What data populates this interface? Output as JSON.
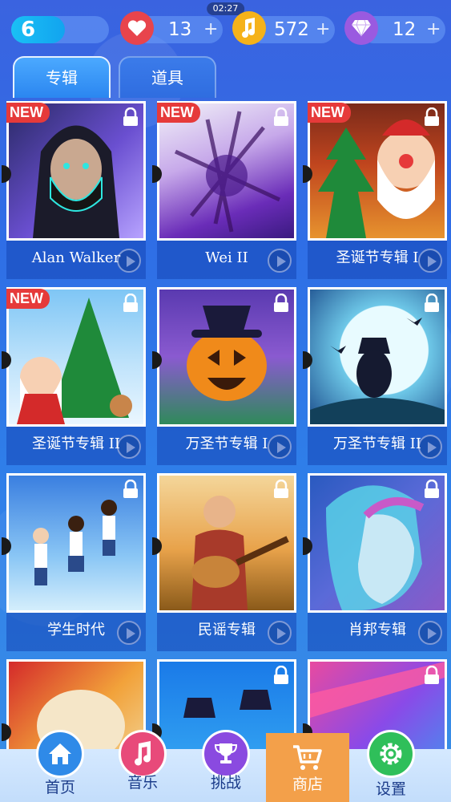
{
  "status": {
    "clock": "02:27"
  },
  "topbar": {
    "level": "6",
    "level_progress": 0.55,
    "hearts": "13",
    "notes": "572",
    "gems": "12",
    "plus": "+"
  },
  "tabs": [
    {
      "label": "专辑",
      "active": true
    },
    {
      "label": "道具",
      "active": false
    }
  ],
  "badge_new": "NEW",
  "albums": [
    {
      "title": "Alan Walker",
      "new": true,
      "locked": true
    },
    {
      "title": "Wei II",
      "new": true,
      "locked": true
    },
    {
      "title": "圣诞节专辑 I",
      "new": true,
      "locked": true
    },
    {
      "title": "圣诞节专辑 II",
      "new": true,
      "locked": true
    },
    {
      "title": "万圣节专辑 I",
      "new": false,
      "locked": true
    },
    {
      "title": "万圣节专辑 II",
      "new": false,
      "locked": true
    },
    {
      "title": "学生时代",
      "new": false,
      "locked": true
    },
    {
      "title": "民谣专辑",
      "new": false,
      "locked": true
    },
    {
      "title": "肖邦专辑",
      "new": false,
      "locked": true
    },
    {
      "title": "",
      "new": false,
      "locked": true
    },
    {
      "title": "",
      "new": false,
      "locked": true
    },
    {
      "title": "",
      "new": false,
      "locked": true
    }
  ],
  "nav": {
    "home": "首页",
    "music": "音乐",
    "challenge": "挑战",
    "shop": "商店",
    "settings": "设置"
  },
  "colors": {
    "heart": "#e8444c",
    "note": "#f5b21a",
    "gem": "#9a5ae0",
    "shop_active": "#f3a04a"
  }
}
